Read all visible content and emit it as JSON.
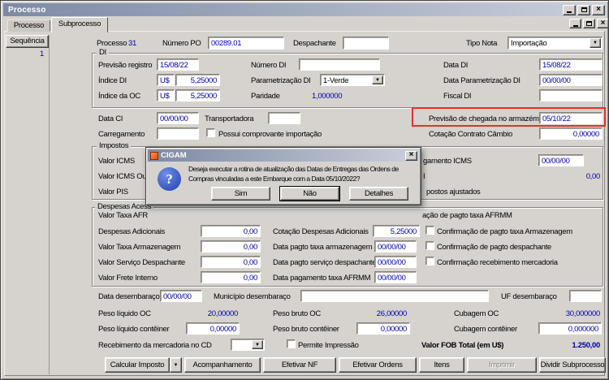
{
  "glyphs": {
    "dropdown_arrow": "▼",
    "close": "×",
    "question_mark": "?"
  },
  "colors": {
    "value_text": "#0000a8",
    "highlight_box": "#e03224",
    "titlebar_start": "#7e8aa4",
    "titlebar_end": "#c9cfdb"
  },
  "window": {
    "title": "Processo"
  },
  "tabs": {
    "processo": "Processo",
    "subprocesso": "Subprocesso"
  },
  "sidebar": {
    "header": "Sequência",
    "row1": "1"
  },
  "top": {
    "processo_label": "Processo",
    "processo_value": "31",
    "numero_po_label": "Número PO",
    "numero_po_value": "00289.01",
    "despachante_label": "Despachante",
    "despachante_value": "",
    "tipo_nota_label": "Tipo Nota",
    "tipo_nota_value": "Importação"
  },
  "di": {
    "legend": "DI",
    "previsao_registro_label": "Previsão registro",
    "previsao_registro_value": "15/08/22",
    "numero_di_label": "Número DI",
    "numero_di_value": "",
    "data_di_label": "Data DI",
    "data_di_value": "15/08/22",
    "indice_di_label": "Índice DI",
    "indice_di_moeda": "U$",
    "indice_di_value": "5,25000",
    "parametrizacao_di_label": "Parametrização DI",
    "parametrizacao_di_value": "1-Verde",
    "data_parametrizacao_di_label": "Data Parametrização DI",
    "data_parametrizacao_di_value": "00/00/00",
    "indice_oc_label": "Índice da OC",
    "indice_oc_moeda": "U$",
    "indice_oc_value": "5,25000",
    "paridade_label": "Paridade",
    "paridade_value": "1,000000",
    "fiscal_di_label": "Fiscal DI",
    "fiscal_di_value": ""
  },
  "embarque": {
    "data_ci_label": "Data CI",
    "data_ci_value": "00/00/00",
    "transportadora_label": "Transportadora",
    "transportadora_value": "",
    "previsao_chegada_label": "Previsão de chegada no armazém",
    "previsao_chegada_value": "05/10/22",
    "carregamento_label": "Carregamento",
    "carregamento_value": "",
    "possui_comprovante_label": "Possui comprovante importação",
    "cotacao_contrato_label": "Cotação Contrato Câmbio",
    "cotacao_contrato_value": "0,00000"
  },
  "impostos": {
    "legend": "Impostos",
    "valor_icms_label": "Valor ICMS",
    "valor_icms_outros_label": "Valor ICMS Outr",
    "valor_pis_label": "Valor PIS",
    "pagamento_icms_fragment": "gamento ICMS",
    "pagamento_icms_value": "00/00/00",
    "icms_fragment": "I",
    "icms_fragment_value": "0,00",
    "impostos_ajustados_fragment": "postos ajustados"
  },
  "despesas": {
    "legend_fragment": "Despesas Acess",
    "valor_taxa_afrmm_fragment": "Valor Taxa AFR",
    "confirmacao_afrmm_fragment": "ação de pagto taxa AFRMM",
    "despesas_adicionais_label": "Despesas Adicionais",
    "despesas_adicionais_value": "0,00",
    "cotacao_despesas_label": "Cotação Despesas Adicionais",
    "cotacao_despesas_value": "5,25000",
    "conf_taxa_armazenagem_label": "Confirmação de pagto taxa Armazenagem",
    "valor_taxa_armazenagem_label": "Valor Taxa Armazenagem",
    "valor_taxa_armazenagem_value": "0,00",
    "data_pagto_armazenagem_label": "Data pagto taxa armazenagem",
    "data_pagto_armazenagem_value": "00/00/00",
    "conf_despachante_label": "Confirmação de pagto despachante",
    "valor_servico_despachante_label": "Valor Serviço Despachante",
    "valor_servico_despachante_value": "0,00",
    "data_pagto_despachante_label": "Data pagto serviço despachante",
    "data_pagto_despachante_value": "00/00/00",
    "conf_recebimento_label": "Confirmação recebimento mercadoria",
    "valor_frete_interno_label": "Valor Frete Interno",
    "valor_frete_interno_value": "0,00",
    "data_pagamento_afrmm_label": "Data pagamento taxa AFRMM",
    "data_pagamento_afrmm_value": "00/00/00"
  },
  "desembaraco": {
    "data_label": "Data desembaraço",
    "data_value": "00/00/00",
    "municipio_label": "Município desembaraço",
    "municipio_value": "",
    "uf_label": "UF desembaraço",
    "uf_value": ""
  },
  "pesos": {
    "peso_liquido_oc_label": "Peso líquido OC",
    "peso_liquido_oc_value": "20,00000",
    "peso_bruto_oc_label": "Peso bruto OC",
    "peso_bruto_oc_value": "26,00000",
    "cubagem_oc_label": "Cubagem OC",
    "cubagem_oc_value": "30,000000",
    "peso_liquido_conteiner_label": "Peso líquido contêiner",
    "peso_liquido_conteiner_value": "0,00000",
    "peso_bruto_conteiner_label": "Peso bruto contêiner",
    "peso_bruto_conteiner_value": "0,00000",
    "cubagem_conteiner_label": "Cubagem contêiner",
    "cubagem_conteiner_value": "0,000000"
  },
  "recebimento": {
    "recebimento_cd_label": "Recebimento da mercadoria no CD",
    "recebimento_cd_value": "",
    "permite_impressao_label": "Permite Impressão",
    "valor_fob_label": "Valor FOB Total (em U$)",
    "valor_fob_value": "1.250,00"
  },
  "footer": {
    "calcular_imposto": "Calcular Imposto",
    "acompanhamento": "Acompanhamento",
    "efetivar_nf": "Efetivar NF",
    "efetivar_ordens": "Efetivar Ordens",
    "itens": "Itens",
    "imprimir": "Imprimir",
    "dividir_subprocesso": "Dividir Subprocesso"
  },
  "dialog": {
    "title": "CIGAM",
    "message_line1": "Deseja executar a rotina de atualização das Datas de Entregas das Ordens de",
    "message_line2": "Compras vinculadas a este Embarque com a Data 05/10/2022?",
    "sim": "Sim",
    "nao": "Não",
    "detalhes": "Detalhes"
  }
}
